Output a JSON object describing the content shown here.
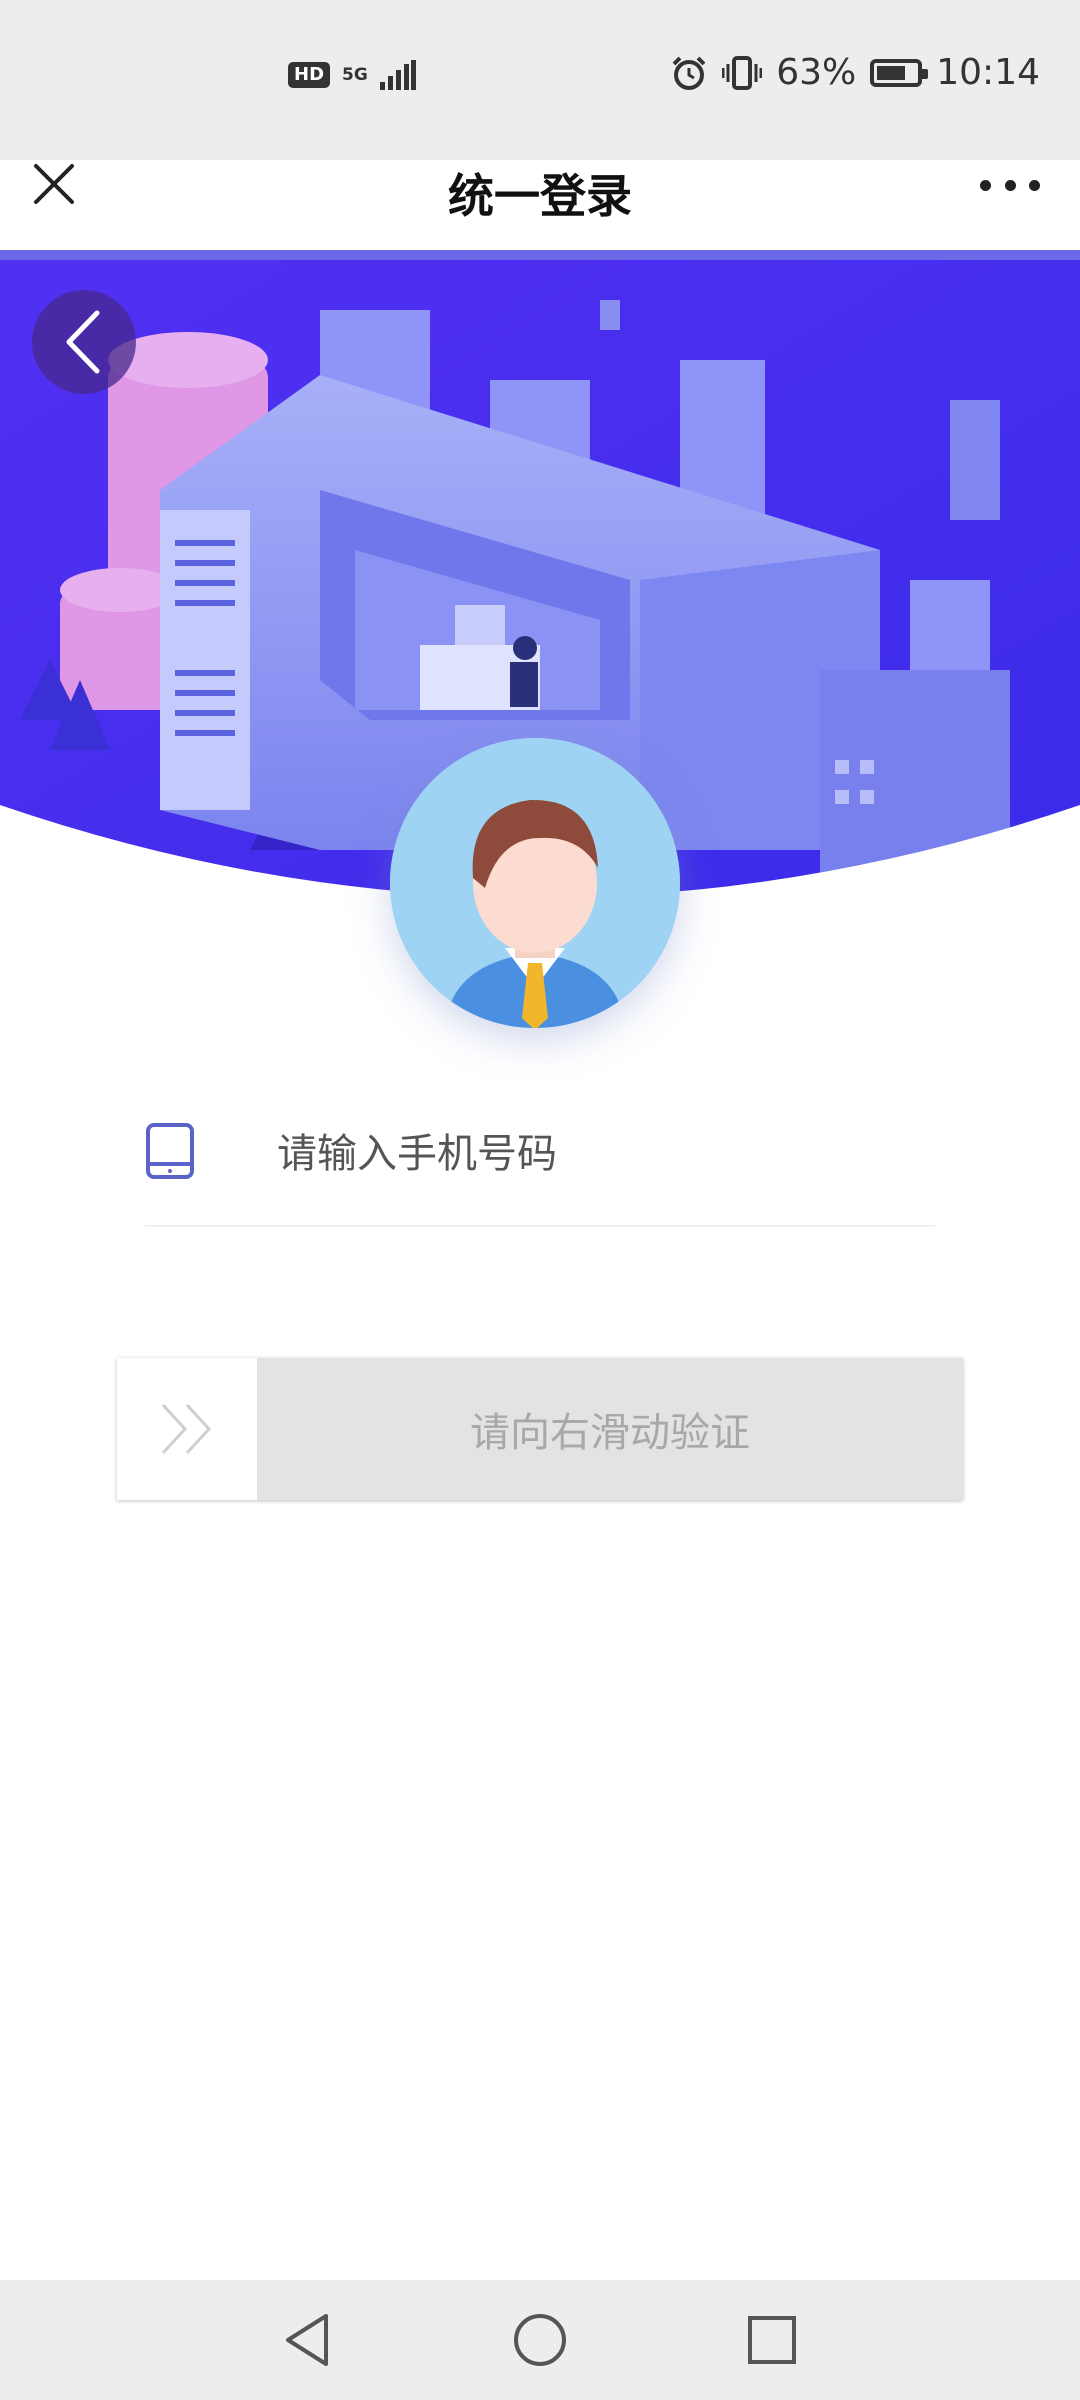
{
  "status_bar": {
    "hd": "HD",
    "network": "5G",
    "battery_percent": "63%",
    "battery_level": 0.63,
    "time": "10:14",
    "icons": [
      "alarm-icon",
      "vibrate-icon",
      "battery-icon",
      "signal-icon"
    ]
  },
  "title_bar": {
    "title": "统一登录",
    "close_icon": "close-icon",
    "more_icon": "more-icon"
  },
  "banner": {
    "back_icon": "chevron-left-icon",
    "colors": {
      "top": "#4a2ff0",
      "bottom": "#6f5cf6",
      "building": "#8a94f5"
    }
  },
  "form": {
    "phone_placeholder": "请输入手机号码",
    "phone_value": "",
    "slider_text": "请向右滑动验证"
  },
  "nav_bar": {
    "icons": [
      "back-triangle-icon",
      "home-circle-icon",
      "recents-square-icon"
    ]
  }
}
